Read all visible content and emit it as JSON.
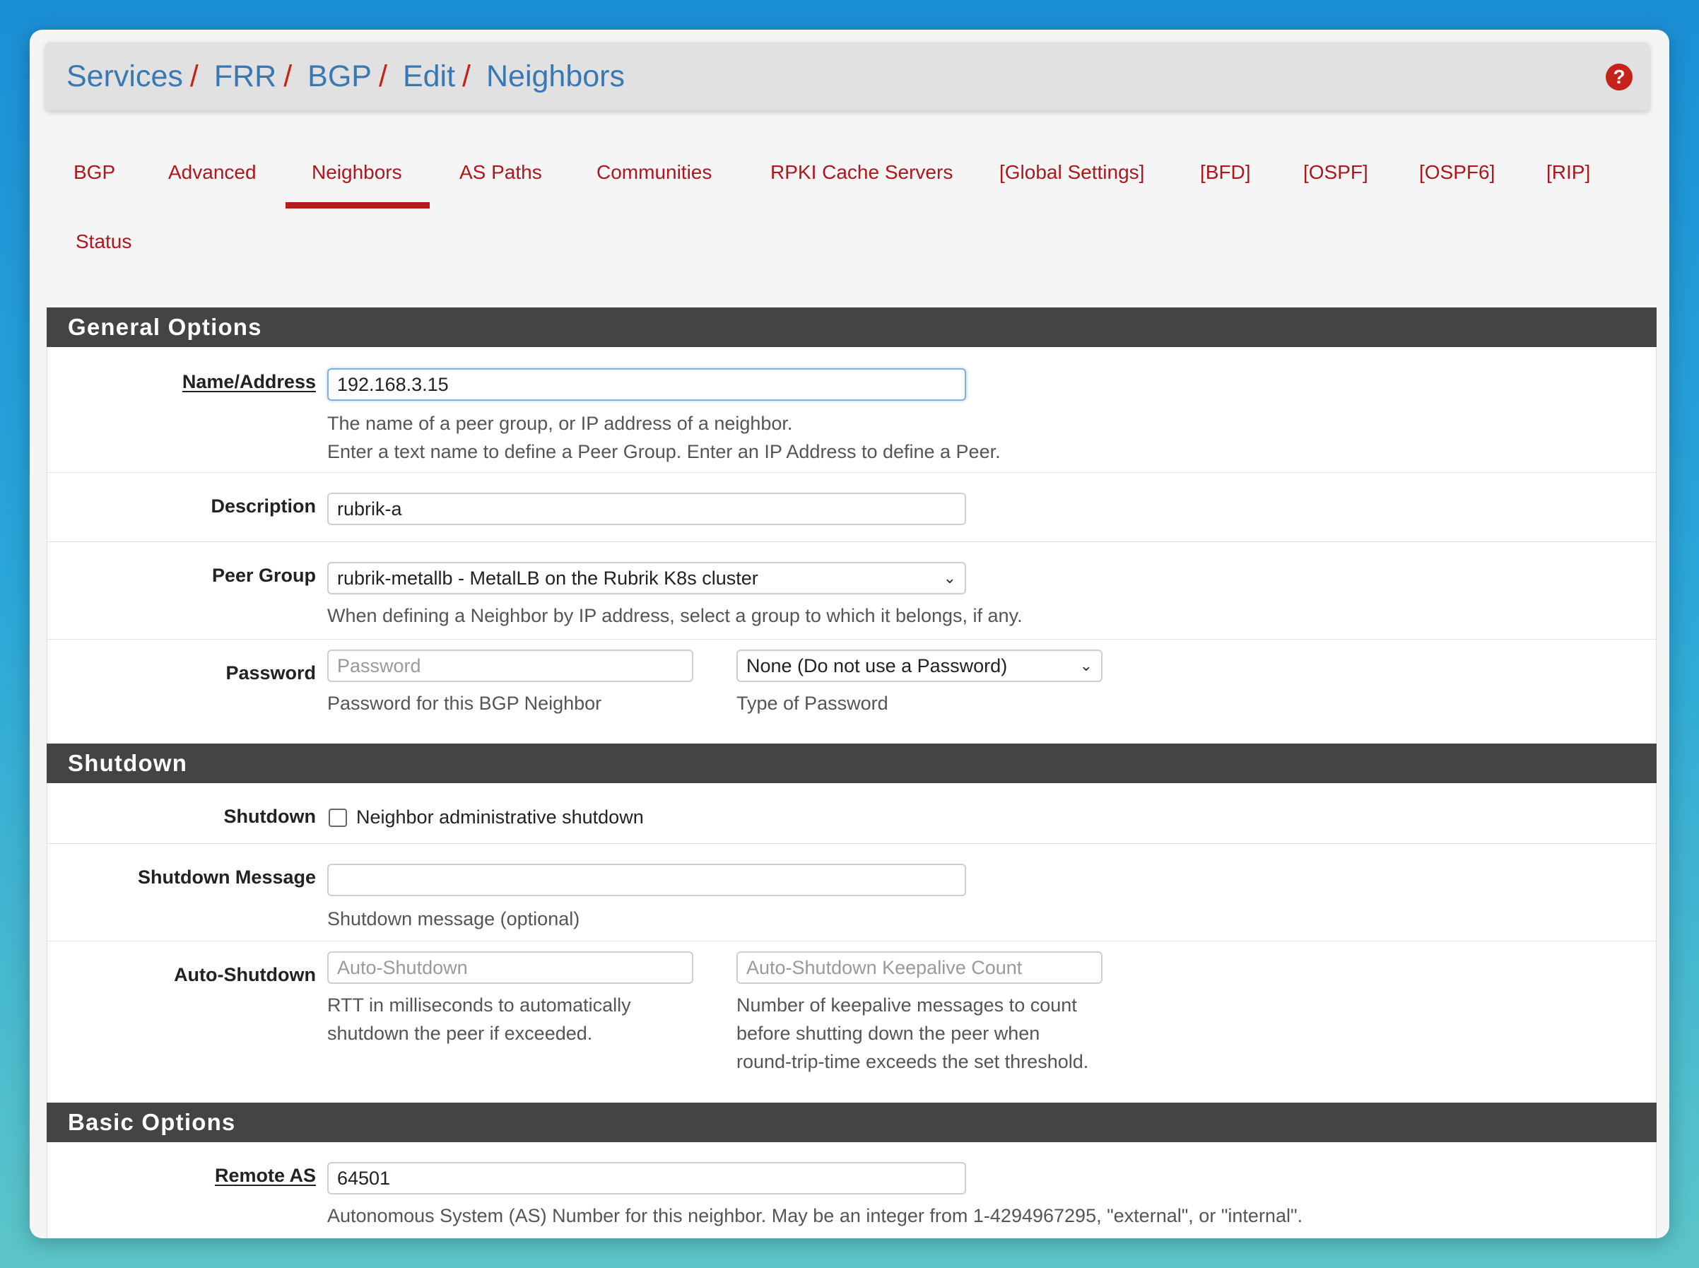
{
  "breadcrumb": {
    "items": [
      "Services",
      "FRR",
      "BGP",
      "Edit",
      "Neighbors"
    ],
    "separator": "/"
  },
  "tabs": {
    "items": [
      "BGP",
      "Advanced",
      "Neighbors",
      "AS Paths",
      "Communities",
      "RPKI Cache Servers",
      "[Global Settings]",
      "[BFD]",
      "[OSPF]",
      "[OSPF6]",
      "[RIP]",
      "Status"
    ],
    "active": "Neighbors"
  },
  "general": {
    "title": "General Options",
    "name_label": "Name/Address",
    "name_value": "192.168.3.15",
    "name_help_1": "The name of a peer group, or IP address of a neighbor.",
    "name_help_2": "Enter a text name to define a Peer Group. Enter an IP Address to define a Peer.",
    "desc_label": "Description",
    "desc_value": "rubrik-a",
    "peer_label": "Peer Group",
    "peer_value": "rubrik-metallb - MetalLB on the Rubrik K8s cluster",
    "peer_help": "When defining a Neighbor by IP address, select a group to which it belongs, if any.",
    "pw_label": "Password",
    "pw_placeholder": "Password",
    "pw_help": "Password for this BGP Neighbor",
    "pw_type_value": "None (Do not use a Password)",
    "pw_type_help": "Type of Password"
  },
  "shutdown": {
    "title": "Shutdown",
    "label": "Shutdown",
    "checkbox_label": "Neighbor administrative shutdown",
    "checked": false,
    "msg_label": "Shutdown Message",
    "msg_value": "",
    "msg_help": "Shutdown message (optional)",
    "auto_label": "Auto-Shutdown",
    "auto_placeholder": "Auto-Shutdown",
    "auto_help_1": "RTT in milliseconds to automatically",
    "auto_help_2": "shutdown the peer if exceeded.",
    "keep_placeholder": "Auto-Shutdown Keepalive Count",
    "keep_help_1": "Number of keepalive messages to count",
    "keep_help_2": "before shutting down the peer when",
    "keep_help_3": "round-trip-time exceeds the set threshold."
  },
  "basic": {
    "title": "Basic Options",
    "remote_label": "Remote AS",
    "remote_value": "64501",
    "remote_help": "Autonomous System (AS) Number for this neighbor. May be an integer from 1-4294967295, \"external\", or \"internal\"."
  },
  "colors": {
    "link_blue": "#3a78b4",
    "tab_red": "#b0161b",
    "panel_dark": "#444444"
  }
}
